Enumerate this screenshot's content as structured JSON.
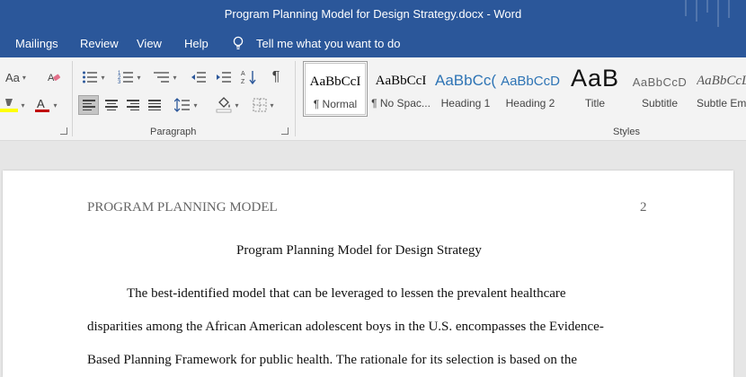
{
  "window": {
    "title": "Program Planning Model for Design Strategy.docx  -  Word"
  },
  "menu": {
    "items": [
      "Mailings",
      "Review",
      "View",
      "Help"
    ],
    "tell_me": "Tell me what you want to do"
  },
  "ribbon": {
    "font_aa": "Aa",
    "paragraph_label": "Paragraph",
    "styles_label": "Styles",
    "pilcrow": "¶",
    "styles": [
      {
        "preview": "AaBbCcI",
        "name": "¶ Normal"
      },
      {
        "preview": "AaBbCcI",
        "name": "¶ No Spac..."
      },
      {
        "preview": "AaBbCc(",
        "name": "Heading 1"
      },
      {
        "preview": "AaBbCcD",
        "name": "Heading 2"
      },
      {
        "preview": "AaB",
        "name": "Title"
      },
      {
        "preview": "AaBbCcD",
        "name": "Subtitle"
      },
      {
        "preview": "AaBbCcL",
        "name": "Subtle Em..."
      }
    ],
    "colors": {
      "highlight": "#ffff00",
      "font_color": "#c00000",
      "accent": "#2b579a"
    }
  },
  "document": {
    "header_left": "PROGRAM PLANNING MODEL",
    "page_number": "2",
    "title": "Program Planning Model for Design Strategy",
    "lines": [
      "The best-identified model that can be leveraged to lessen the prevalent healthcare",
      "disparities among the African American adolescent boys in the U.S. encompasses the Evidence-",
      "Based Planning Framework for public health. The rationale for its selection is based on the"
    ]
  }
}
